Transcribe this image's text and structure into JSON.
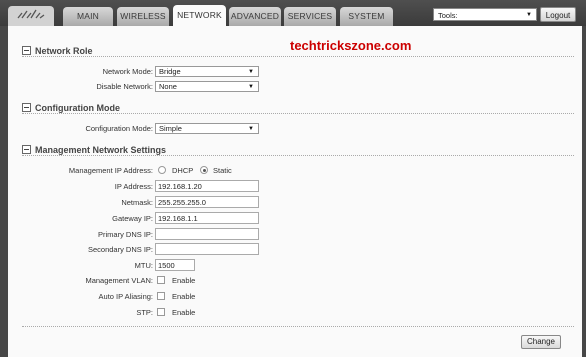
{
  "nav": {
    "tabs": [
      {
        "label": "MAIN"
      },
      {
        "label": "WIRELESS"
      },
      {
        "label": "NETWORK",
        "active": true
      },
      {
        "label": "ADVANCED"
      },
      {
        "label": "SERVICES"
      },
      {
        "label": "SYSTEM"
      }
    ],
    "tools_label": "Tools:",
    "logout_label": "Logout",
    "logo_icon": "ubiquiti-logo-icon"
  },
  "watermark": "techtrickszone.com",
  "network_role": {
    "title": "Network Role",
    "network_mode_label": "Network Mode:",
    "network_mode_value": "Bridge",
    "disable_network_label": "Disable Network:",
    "disable_network_value": "None"
  },
  "configuration_mode": {
    "title": "Configuration Mode",
    "configuration_mode_label": "Configuration Mode:",
    "configuration_mode_value": "Simple"
  },
  "management": {
    "title": "Management Network Settings",
    "ip_address_mode_label": "Management IP Address:",
    "dhcp_label": "DHCP",
    "static_label": "Static",
    "selected_mode": "Static",
    "ip_address_label": "IP Address:",
    "ip_address_value": "192.168.1.20",
    "netmask_label": "Netmask:",
    "netmask_value": "255.255.255.0",
    "gateway_label": "Gateway IP:",
    "gateway_value": "192.168.1.1",
    "primary_dns_label": "Primary DNS IP:",
    "primary_dns_value": "",
    "secondary_dns_label": "Secondary DNS IP:",
    "secondary_dns_value": "",
    "mtu_label": "MTU:",
    "mtu_value": "1500",
    "vlan_label": "Management VLAN:",
    "vlan_option": "Enable",
    "aliasing_label": "Auto IP Aliasing:",
    "aliasing_option": "Enable",
    "stp_label": "STP:",
    "stp_option": "Enable"
  },
  "footer": {
    "change_label": "Change"
  },
  "colors": {
    "background": "#474747",
    "panel": "#fafafa",
    "watermark": "#cc0000"
  }
}
